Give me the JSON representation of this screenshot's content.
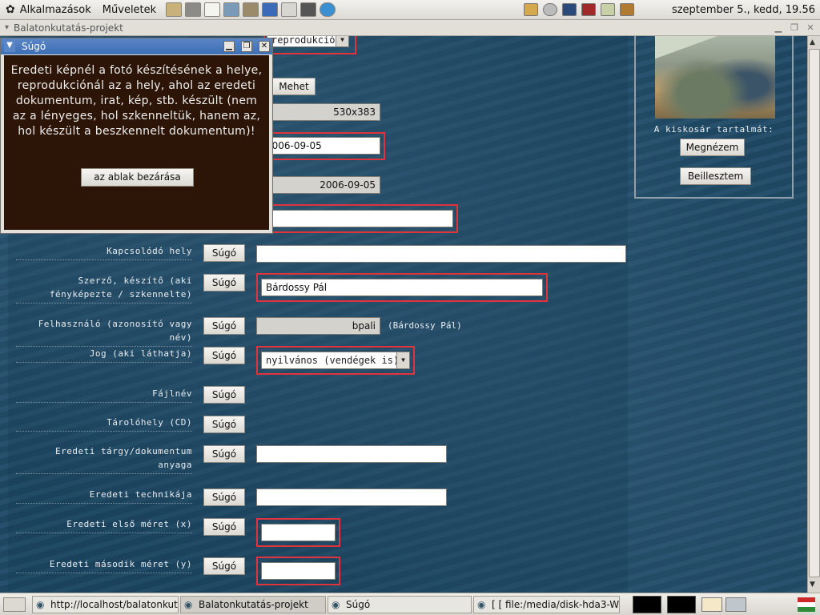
{
  "top_panel": {
    "applications": "Alkalmazások",
    "actions": "Műveletek",
    "clock": "szeptember 5., kedd, 19.56"
  },
  "window": {
    "title": "Balatonkutatás-projekt"
  },
  "popup": {
    "title": "Súgó",
    "text": "Eredeti képnél a fotó készítésének a helye, reprodukciónál az a hely, ahol az eredeti dokumentum, irat, kép, stb. készült (nem az a lényeges, hol szkenneltük, hanem az, hol készült a beszkennelt dokumentum)!",
    "close_button": "az ablak bezárása"
  },
  "form_top": {
    "select_value": "reprodukció",
    "go_button": "Mehet",
    "size_value": "530x383",
    "date_value": "2006-09-05",
    "date_readonly": "2006-09-05"
  },
  "help_label": "Súgó",
  "fields": {
    "related_place": {
      "label": "Kapcsolódó hely",
      "value": ""
    },
    "author": {
      "label": "Szerző, készítő (aki fényképezte / szkennelte)",
      "value": "Bárdossy Pál"
    },
    "user": {
      "label": "Felhasználó (azonosító vagy név)",
      "value": "bpali",
      "note": "(Bárdossy Pál)"
    },
    "rights": {
      "label": "Jog (aki láthatja)",
      "value": "nyilvános (vendégek is)"
    },
    "filename": {
      "label": "Fájlnév"
    },
    "storage": {
      "label": "Tárolóhely (CD)"
    },
    "material": {
      "label": "Eredeti tárgy/dokumentum anyaga",
      "value": ""
    },
    "technique": {
      "label": "Eredeti technikája",
      "value": ""
    },
    "size_x": {
      "label": "Eredeti első méret (x)",
      "value": ""
    },
    "size_y": {
      "label": "Eredeti második méret (y)",
      "value": ""
    }
  },
  "cart": {
    "label": "A kiskosár tartalmát:",
    "view_button": "Megnézem",
    "paste_button": "Beillesztem"
  },
  "taskbar": {
    "task1": "http://localhost/balatonkuta",
    "task2": "Balatonkutatás-projekt",
    "task3": "Súgó",
    "task4": "[ [  file:/media/disk-hda3-W"
  }
}
